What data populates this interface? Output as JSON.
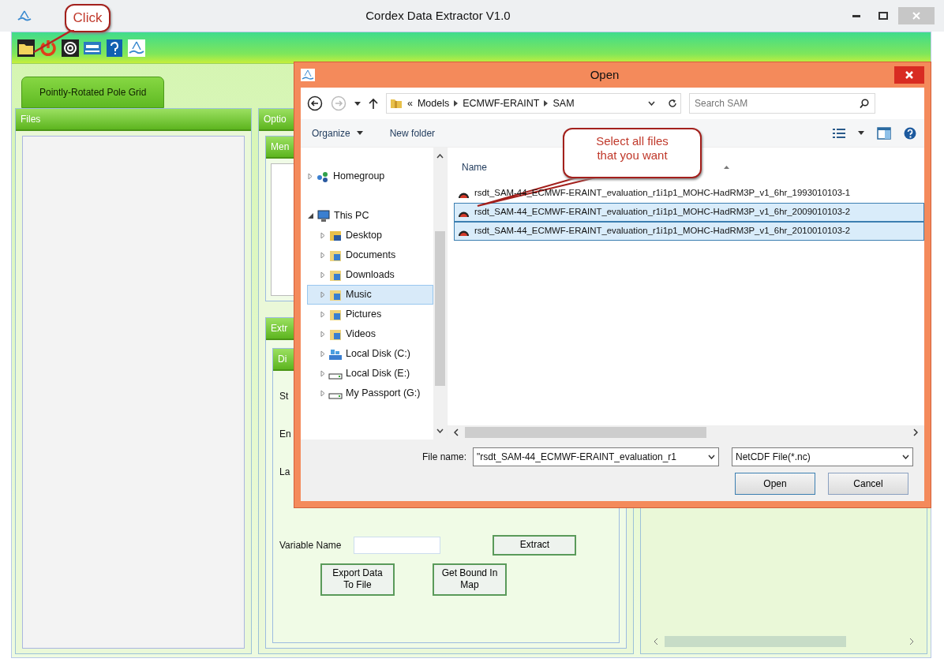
{
  "window": {
    "title": "Cordex Data Extractor V1.0"
  },
  "callouts": [
    {
      "text": "Click"
    },
    {
      "text": "Select all files that you want"
    }
  ],
  "tabs": [
    {
      "label": "Pointly-Rotated Pole Grid",
      "selected": true
    }
  ],
  "files_panel": {
    "title": "Files"
  },
  "options_panel": {
    "title": "Optio",
    "menu_title": "Men",
    "extract_title": "Extr",
    "group_title": "Di",
    "labels": [
      "St",
      "En",
      "La"
    ],
    "variable_label": "Variable Name",
    "extract_button": "Extract",
    "buttons": [
      "Export Data To File",
      "Get Bound In Map"
    ]
  },
  "dialog": {
    "title": "Open",
    "path_prefix": "«",
    "path": [
      "Models",
      "ECMWF-ERAINT",
      "SAM"
    ],
    "search": {
      "placeholder": "Search SAM"
    },
    "commands": [
      "Organize",
      "New folder"
    ],
    "nav": [
      {
        "label": "Homegroup",
        "kind": "network",
        "expanded": false,
        "selected": false
      },
      {
        "label": "This PC",
        "kind": "computer",
        "expanded": true,
        "selected": false,
        "children": [
          {
            "label": "Desktop",
            "kind": "desktop",
            "expanded": false,
            "selected": false
          },
          {
            "label": "Documents",
            "kind": "folder",
            "expanded": false,
            "selected": false
          },
          {
            "label": "Downloads",
            "kind": "folder",
            "expanded": false,
            "selected": false
          },
          {
            "label": "Music",
            "kind": "folder",
            "expanded": false,
            "selected": true
          },
          {
            "label": "Pictures",
            "kind": "folder",
            "expanded": false,
            "selected": false
          },
          {
            "label": "Videos",
            "kind": "folder",
            "expanded": false,
            "selected": false
          },
          {
            "label": "Local Disk (C:)",
            "kind": "system-drive",
            "expanded": false,
            "selected": false
          },
          {
            "label": "Local Disk (E:)",
            "kind": "drive",
            "expanded": false,
            "selected": false
          },
          {
            "label": "My Passport (G:)",
            "kind": "drive",
            "expanded": false,
            "selected": false
          }
        ]
      }
    ],
    "column": "Name",
    "files": [
      {
        "name": "rsdt_SAM-44_ECMWF-ERAINT_evaluation_r1i1p1_MOHC-HadRM3P_v1_6hr_1993010103-1",
        "selected": false
      },
      {
        "name": "rsdt_SAM-44_ECMWF-ERAINT_evaluation_r1i1p1_MOHC-HadRM3P_v1_6hr_2009010103-2",
        "selected": true
      },
      {
        "name": "rsdt_SAM-44_ECMWF-ERAINT_evaluation_r1i1p1_MOHC-HadRM3P_v1_6hr_2010010103-2",
        "selected": true
      }
    ],
    "file_name": {
      "label": "File name:",
      "value": "\"rsdt_SAM-44_ECMWF-ERAINT_evaluation_r1"
    },
    "file_type": "NetCDF File(*.nc)",
    "buttons": [
      "Open",
      "Cancel"
    ]
  }
}
